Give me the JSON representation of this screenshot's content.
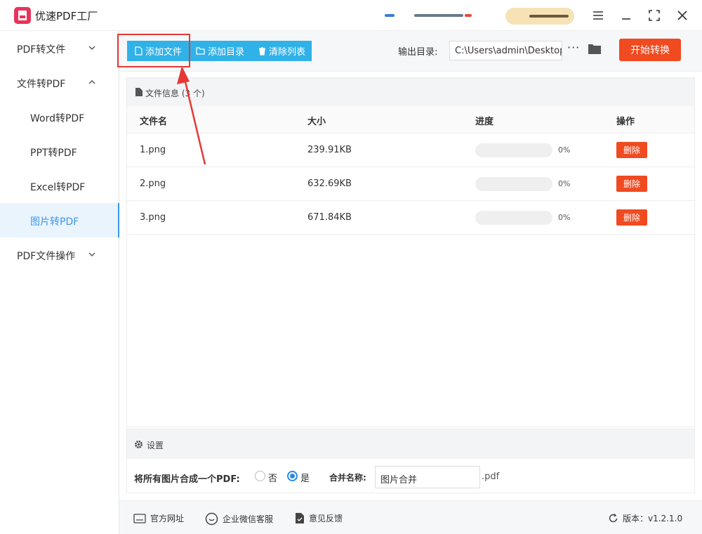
{
  "app": {
    "title": "优速PDF工厂"
  },
  "window": {
    "menu_icon": "hamburger-icon",
    "minimize_icon": "minimize-icon",
    "maximize_icon": "fullscreen-icon",
    "close_icon": "close-icon"
  },
  "sidebar": {
    "items": [
      {
        "label": "PDF转文件",
        "expanded": false
      },
      {
        "label": "文件转PDF",
        "expanded": true
      },
      {
        "label": "Word转PDF"
      },
      {
        "label": "PPT转PDF"
      },
      {
        "label": "Excel转PDF"
      },
      {
        "label": "图片转PDF",
        "active": true
      },
      {
        "label": "PDF文件操作",
        "expanded": false
      }
    ]
  },
  "toolbar": {
    "add_file": "添加文件",
    "add_folder": "添加目录",
    "clear_list": "清除列表",
    "output_label": "输出目录:",
    "output_path": "C:\\Users\\admin\\Desktop",
    "more": "···",
    "start": "开始转换"
  },
  "files": {
    "header_prefix": "文件信息",
    "header_count": "(3 个)",
    "columns": {
      "name": "文件名",
      "size": "大小",
      "progress": "进度",
      "action": "操作"
    },
    "rows": [
      {
        "name": "1.png",
        "size": "239.91KB",
        "progress": "0%",
        "progress_value": 0,
        "action": "删除"
      },
      {
        "name": "2.png",
        "size": "632.69KB",
        "progress": "0%",
        "progress_value": 0,
        "action": "删除"
      },
      {
        "name": "3.png",
        "size": "671.84KB",
        "progress": "0%",
        "progress_value": 0,
        "action": "删除"
      }
    ]
  },
  "settings": {
    "title": "设置",
    "merge_label": "将所有图片合成一个PDF:",
    "option_no": "否",
    "option_yes": "是",
    "selected": "是",
    "name_label": "合并名称:",
    "name_value": "图片合并",
    "ext": ".pdf"
  },
  "footer": {
    "website": "官方网址",
    "wechat": "企业微信客服",
    "feedback": "意见反馈",
    "version": "版本：v1.2.1.0"
  },
  "colors": {
    "accent": "#30b2e8",
    "danger": "#f04a20",
    "annotation": "#e53935",
    "active_nav": "#3a98e8"
  }
}
